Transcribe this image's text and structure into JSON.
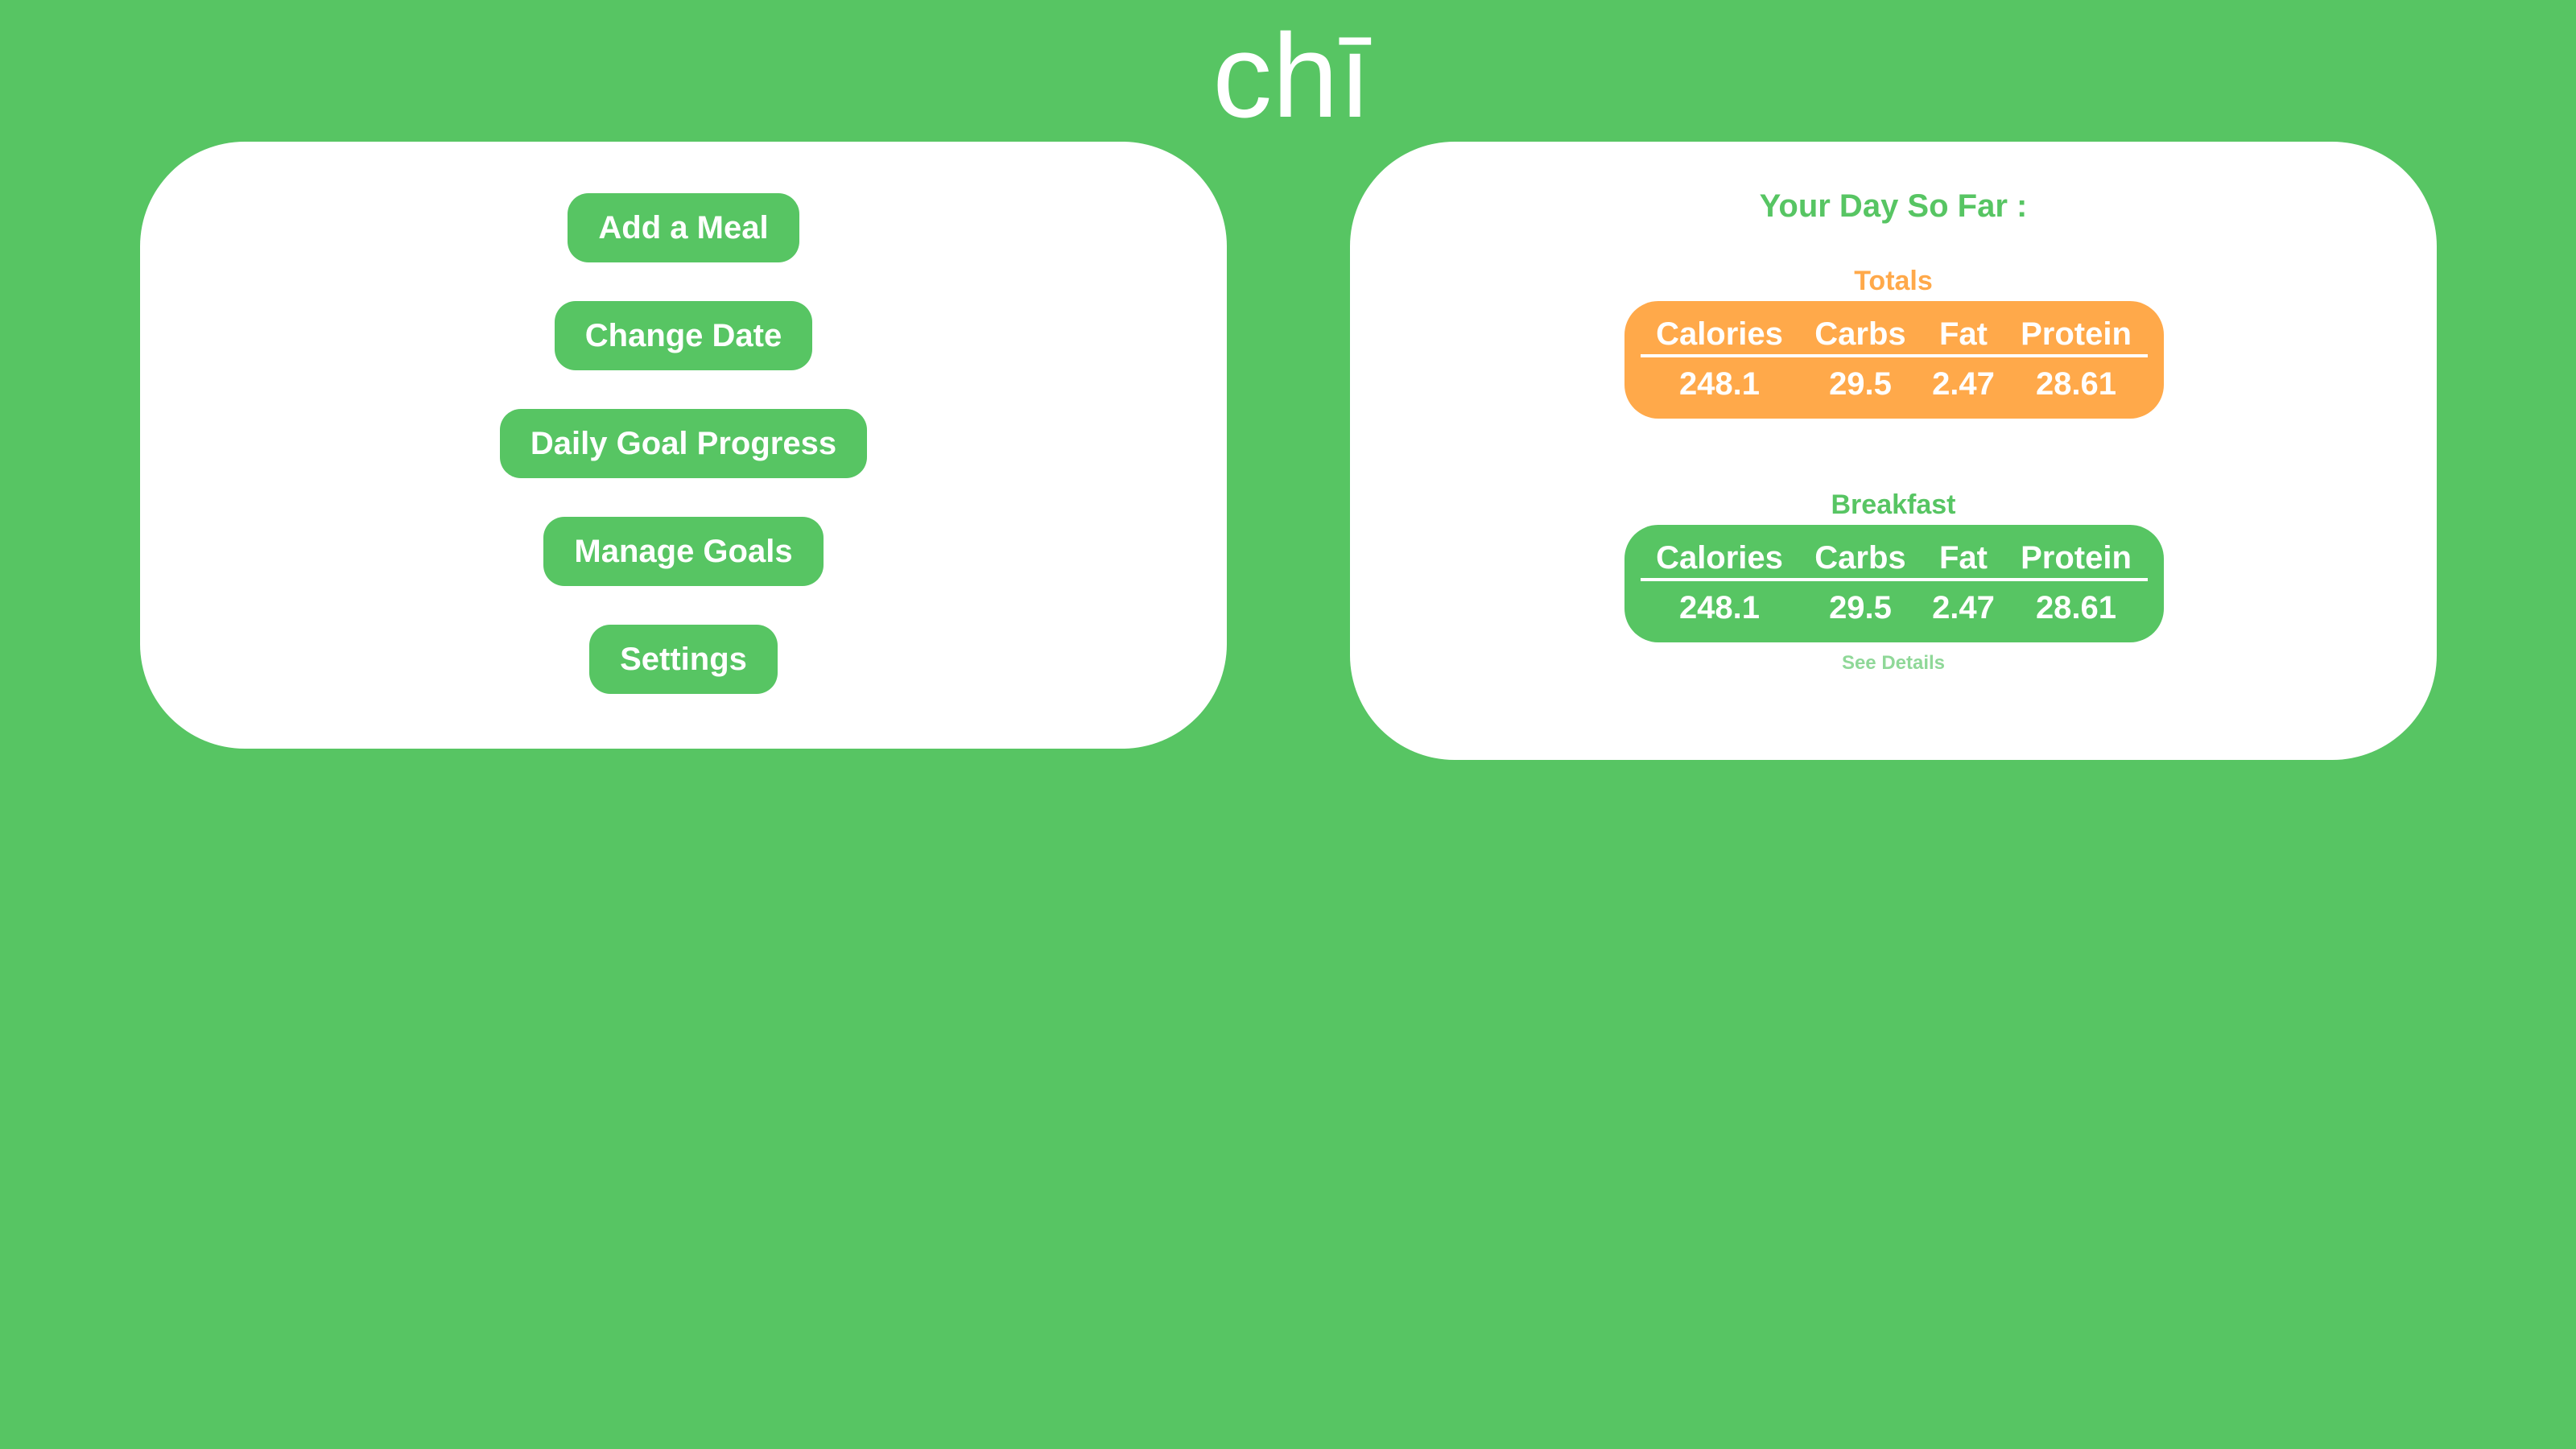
{
  "app": {
    "logo_text": "chī"
  },
  "menu": {
    "items": [
      {
        "label": "Add a Meal"
      },
      {
        "label": "Change Date"
      },
      {
        "label": "Daily Goal Progress"
      },
      {
        "label": "Manage Goals"
      },
      {
        "label": "Settings"
      }
    ]
  },
  "summary": {
    "title": "Your Day So Far :",
    "totals": {
      "label": "Totals",
      "headers": [
        "Calories",
        "Carbs",
        "Fat",
        "Protein"
      ],
      "values": [
        "248.1",
        "29.5",
        "2.47",
        "28.61"
      ]
    },
    "breakfast": {
      "label": "Breakfast",
      "headers": [
        "Calories",
        "Carbs",
        "Fat",
        "Protein"
      ],
      "values": [
        "248.1",
        "29.5",
        "2.47",
        "28.61"
      ],
      "details_link": "See Details"
    }
  },
  "colors": {
    "background": "#57c563",
    "panel": "#ffffff",
    "accent_orange": "#ffa94a",
    "link_muted": "#8fd898"
  }
}
